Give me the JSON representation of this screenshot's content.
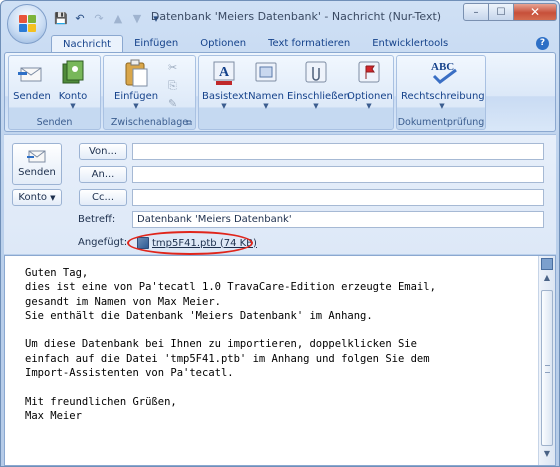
{
  "window": {
    "title": "Datenbank 'Meiers Datenbank' - Nachricht (Nur-Text)",
    "controls": {
      "minimize": "–",
      "maximize": "☐",
      "close": "✕"
    }
  },
  "quick_access": [
    {
      "icon": "save-icon",
      "glyph": "💾"
    },
    {
      "icon": "undo-icon",
      "glyph": "↶"
    },
    {
      "icon": "redo-icon",
      "glyph": "↷"
    },
    {
      "icon": "up-icon",
      "glyph": "▲"
    },
    {
      "icon": "down-icon",
      "glyph": "▼"
    },
    {
      "icon": "customize-icon",
      "glyph": "▾"
    }
  ],
  "tabs": [
    "Nachricht",
    "Einfügen",
    "Optionen",
    "Text formatieren",
    "Entwicklertools"
  ],
  "active_tab": "Nachricht",
  "help_glyph": "?",
  "ribbon": {
    "groups": [
      {
        "label": "Senden",
        "buttons": [
          "Senden",
          "Konto"
        ]
      },
      {
        "label": "Zwischenablage",
        "buttons": [
          "Einfügen"
        ]
      },
      {
        "label": "",
        "buttons": [
          "Basistext",
          "Namen",
          "Einschließen",
          "Optionen"
        ]
      },
      {
        "label": "Dokumentprüfung",
        "buttons": [
          "Rechtschreibung"
        ]
      }
    ]
  },
  "header": {
    "send_label": "Senden",
    "account_label": "Konto",
    "von": "Von...",
    "an": "An...",
    "cc": "Cc...",
    "betreff_label": "Betreff:",
    "betreff_value": "Datenbank 'Meiers Datenbank'",
    "angefuegt_label": "Angefügt:",
    "attachment": "tmp5F41.ptb (74 KB)",
    "highlight_color": "#e0251b"
  },
  "body": {
    "lines": [
      "Guten Tag,",
      "dies ist eine von Pa'tecatl 1.0 TravaCare-Edition erzeugte Email,",
      "gesandt im Namen von Max Meier.",
      "Sie enthält die Datenbank 'Meiers Datenbank' im Anhang.",
      "",
      "Um diese Datenbank bei Ihnen zu importieren, doppelklicken Sie",
      "einfach auf die Datei 'tmp5F41.ptb' im Anhang und folgen Sie dem",
      "Import-Assistenten von Pa'tecatl.",
      "",
      "Mit freundlichen Grüßen,",
      "Max Meier"
    ]
  },
  "colors": {
    "ribbon_text": "#15428b",
    "frame": "#bcd1ec",
    "close_button": "#c7503a"
  }
}
